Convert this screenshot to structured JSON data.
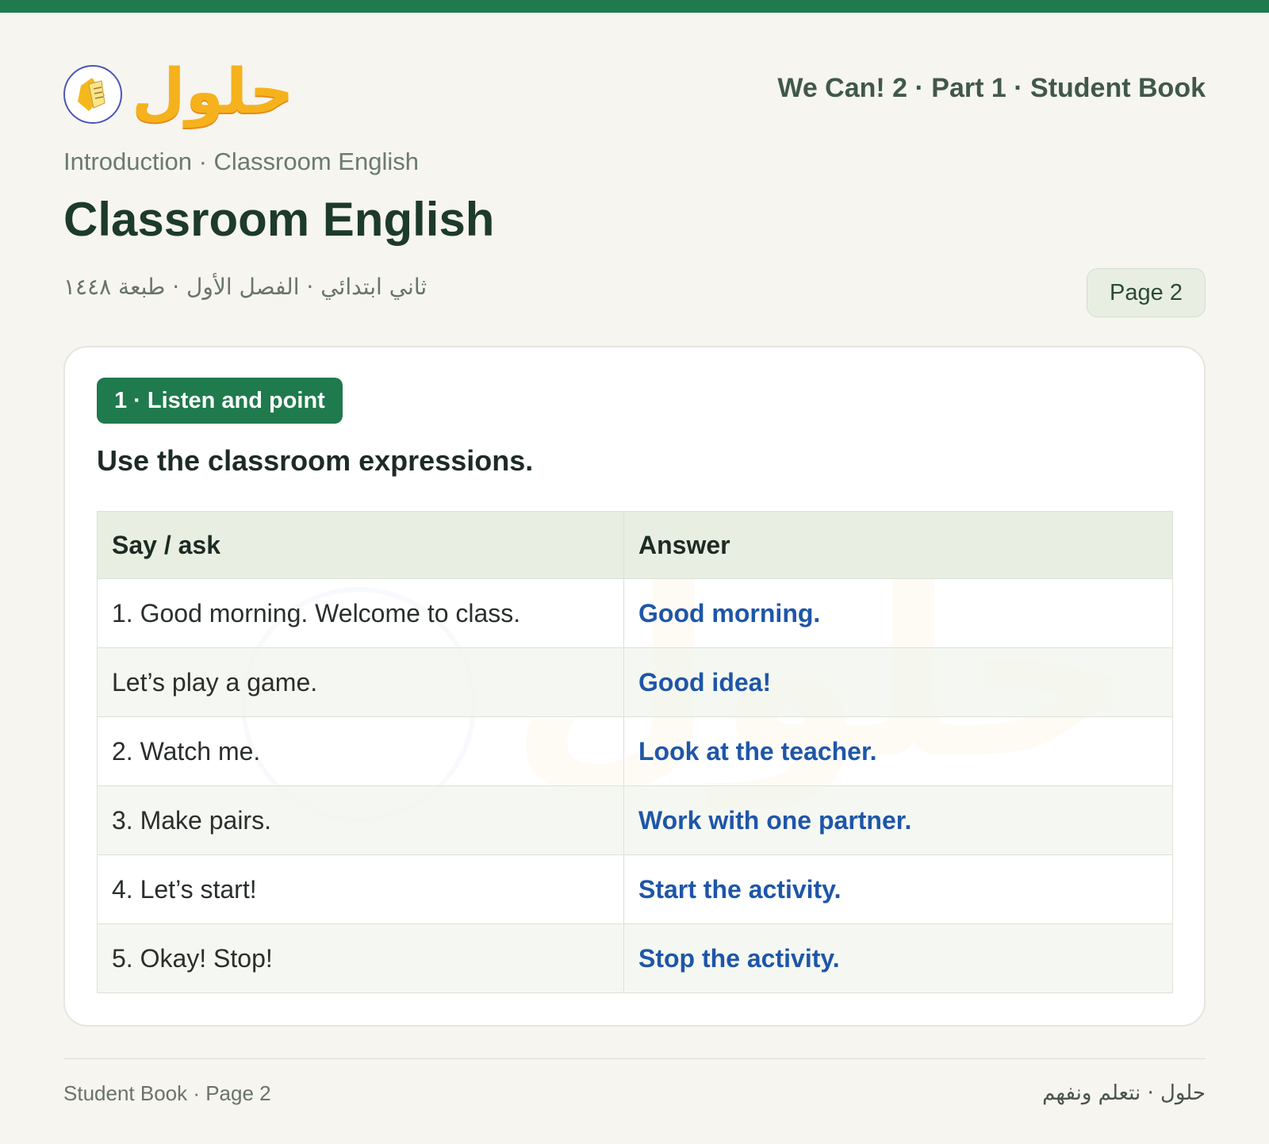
{
  "header": {
    "logo_text": "حلول",
    "book_title": "We Can! 2 · Part 1 · Student Book"
  },
  "breadcrumb": "Introduction · Classroom English",
  "page_title": "Classroom English",
  "arabic_meta": "ثاني ابتدائي · الفصل الأول · طبعة ١٤٤٨",
  "page_badge": "Page 2",
  "exercise": {
    "badge": "1 · Listen and point",
    "instruction": "Use the classroom expressions.",
    "table": {
      "headers": [
        "Say / ask",
        "Answer"
      ],
      "rows": [
        {
          "say": "1. Good morning. Welcome to class.",
          "answer": "Good morning."
        },
        {
          "say": "Let’s play a game.",
          "answer": "Good idea!"
        },
        {
          "say": "2. Watch me.",
          "answer": "Look at the teacher."
        },
        {
          "say": "3. Make pairs.",
          "answer": "Work with one partner."
        },
        {
          "say": "4. Let’s start!",
          "answer": "Start the activity."
        },
        {
          "say": "5. Okay! Stop!",
          "answer": "Stop the activity."
        }
      ]
    }
  },
  "watermark": {
    "text": "حلول",
    "icon": "book-pen-icon"
  },
  "footer": {
    "left": "Student Book · Page 2",
    "right": "حلول · نتعلم ونفهم"
  },
  "colors": {
    "accent": "#1f7a4d",
    "answer": "#1e56a8",
    "logo": "#f5b21c",
    "background": "#f6f5ef"
  }
}
